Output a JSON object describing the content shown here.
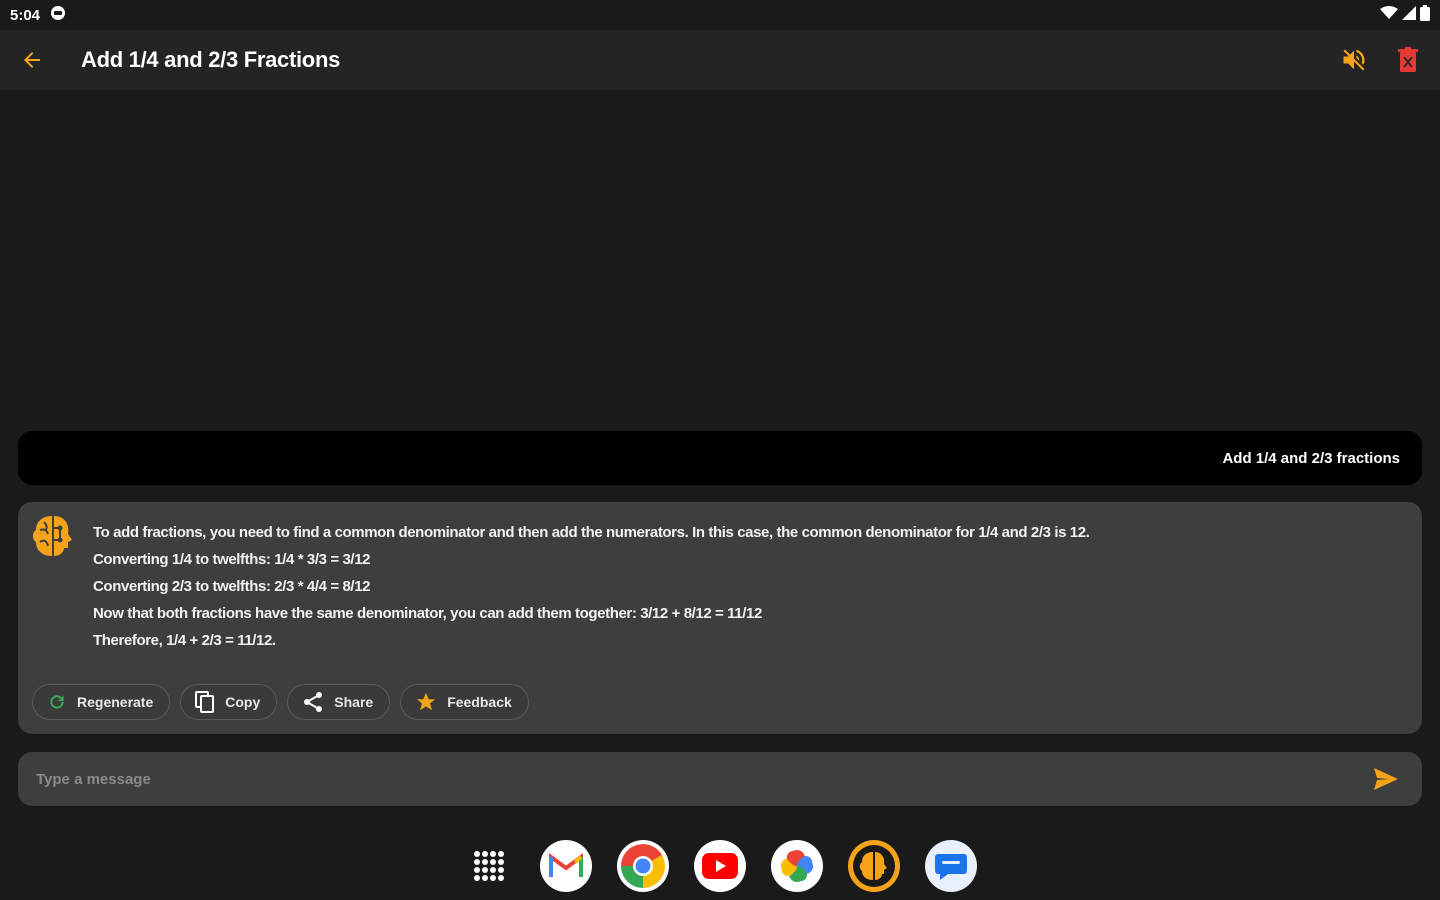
{
  "status_bar": {
    "time": "5:04"
  },
  "app_bar": {
    "title": "Add 1/4 and 2/3 Fractions"
  },
  "conversation": {
    "user_message": "Add 1/4 and 2/3 fractions",
    "bot_lines": [
      "To add fractions, you need to find a common denominator and then add the numerators. In this case, the common denominator for 1/4 and 2/3 is 12.",
      "Converting 1/4 to twelfths: 1/4 * 3/3 = 3/12",
      "Converting 2/3 to twelfths: 2/3 * 4/4 = 8/12",
      "Now that both fractions have the same denominator, you can add them together: 3/12 + 8/12 = 11/12",
      "Therefore, 1/4 + 2/3 = 11/12."
    ],
    "actions": {
      "regenerate": "Regenerate",
      "copy": "Copy",
      "share": "Share",
      "feedback": "Feedback"
    }
  },
  "input": {
    "placeholder": "Type a message"
  },
  "colors": {
    "accent": "#f5a31a",
    "delete": "#e53935",
    "regenerate": "#34a853",
    "background": "#1a1a1a",
    "card": "#3e3e3e"
  },
  "dock": {
    "icons": [
      "app-drawer-icon",
      "gmail-icon",
      "chrome-icon",
      "youtube-icon",
      "photos-icon",
      "brain-app-icon",
      "messages-icon"
    ]
  }
}
